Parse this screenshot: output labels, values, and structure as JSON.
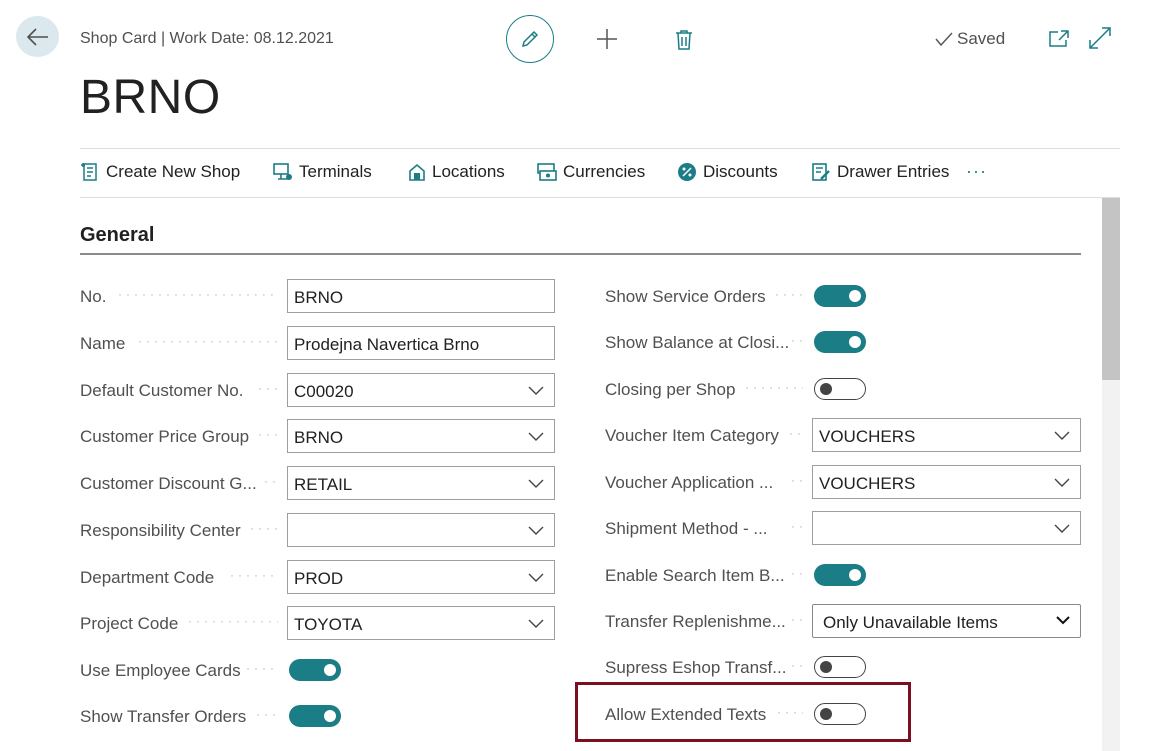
{
  "header": {
    "breadcrumb": "Shop Card | Work Date: 08.12.2021",
    "saved_label": "Saved",
    "page_title": "BRNO"
  },
  "actions": [
    {
      "label": "Create New Shop",
      "icon": "create-shop-icon"
    },
    {
      "label": "Terminals",
      "icon": "terminal-icon"
    },
    {
      "label": "Locations",
      "icon": "location-icon"
    },
    {
      "label": "Currencies",
      "icon": "currency-icon"
    },
    {
      "label": "Discounts",
      "icon": "discount-icon"
    },
    {
      "label": "Drawer Entries",
      "icon": "drawer-entries-icon"
    }
  ],
  "more_label": "···",
  "section": {
    "title": "General"
  },
  "left_fields": [
    {
      "label": "No.",
      "value": "BRNO",
      "type": "text"
    },
    {
      "label": "Name",
      "value": "Prodejna Navertica Brno",
      "type": "text"
    },
    {
      "label": "Default Customer No.",
      "value": "C00020",
      "type": "select"
    },
    {
      "label": "Customer Price Group",
      "value": "BRNO",
      "type": "select"
    },
    {
      "label": "Customer Discount G...",
      "value": "RETAIL",
      "type": "select"
    },
    {
      "label": "Responsibility Center",
      "value": "",
      "type": "select"
    },
    {
      "label": "Department Code",
      "value": "PROD",
      "type": "select"
    },
    {
      "label": "Project Code",
      "value": "TOYOTA",
      "type": "select"
    },
    {
      "label": "Use Employee Cards",
      "value": "on",
      "type": "toggle"
    },
    {
      "label": "Show Transfer Orders",
      "value": "on",
      "type": "toggle"
    }
  ],
  "right_fields": [
    {
      "label": "Show Service Orders",
      "value": "on",
      "type": "toggle"
    },
    {
      "label": "Show Balance at Closi...",
      "value": "on",
      "type": "toggle"
    },
    {
      "label": "Closing per Shop",
      "value": "off",
      "type": "toggle"
    },
    {
      "label": "Voucher Item Category",
      "value": "VOUCHERS",
      "type": "select"
    },
    {
      "label": "Voucher Application ...",
      "value": "VOUCHERS",
      "type": "select"
    },
    {
      "label": "Shipment Method - ...",
      "value": "",
      "type": "select"
    },
    {
      "label": "Enable Search Item B...",
      "value": "on",
      "type": "toggle"
    },
    {
      "label": "Transfer Replenishme...",
      "value": "Only Unavailable Items",
      "type": "select-std"
    },
    {
      "label": "Supress Eshop Transf...",
      "value": "off",
      "type": "toggle"
    },
    {
      "label": "Allow Extended Texts",
      "value": "off",
      "type": "toggle"
    }
  ],
  "colors": {
    "accent": "#1b7d86",
    "highlight": "#7a1020"
  }
}
